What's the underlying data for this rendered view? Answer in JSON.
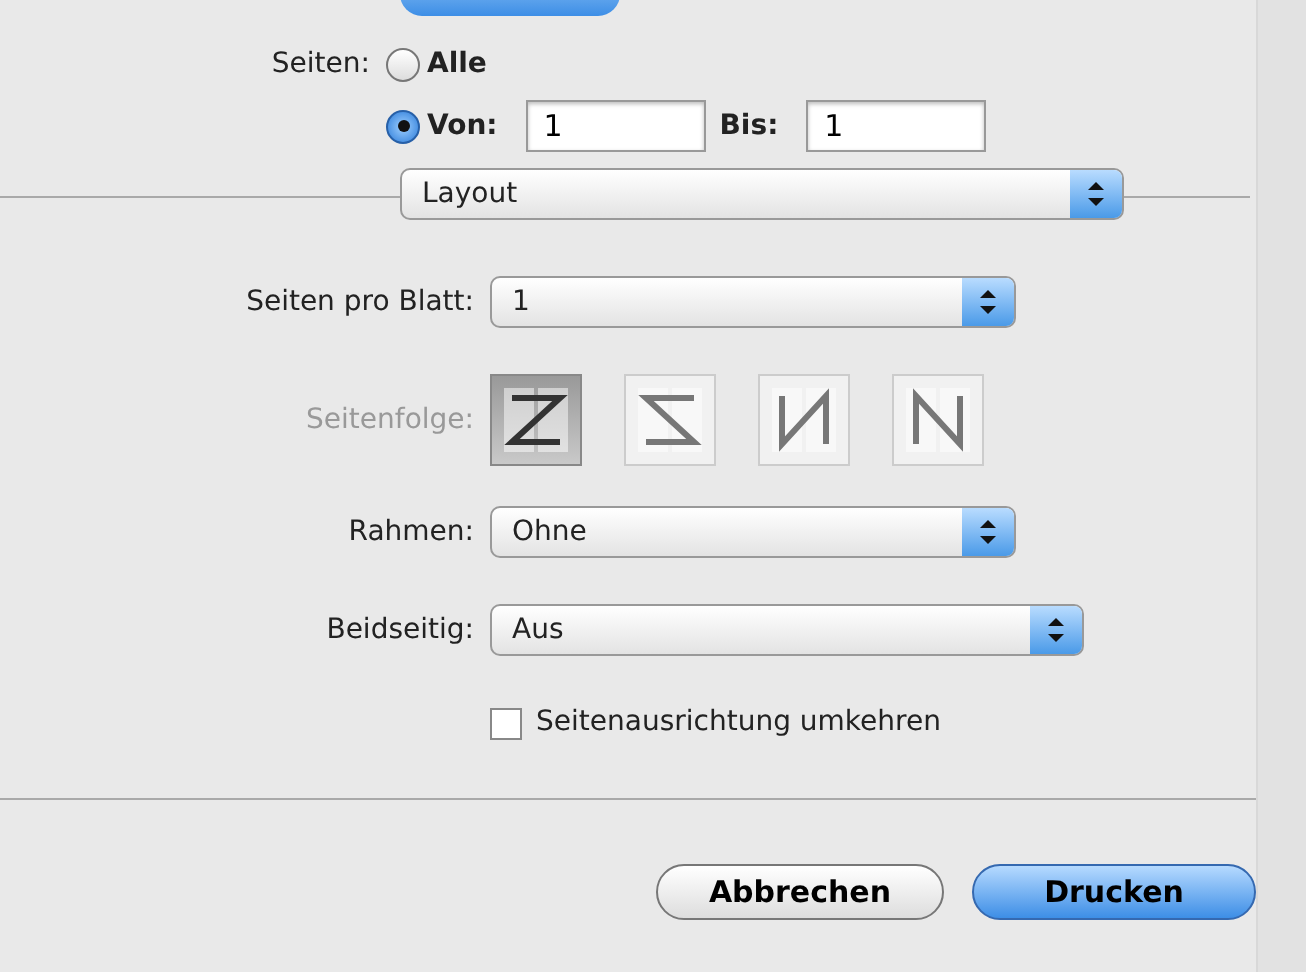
{
  "pages": {
    "label": "Seiten:",
    "options": [
      {
        "kind": "all",
        "label": "Alle",
        "selected": false
      },
      {
        "kind": "range",
        "label": "Von:",
        "selected": true,
        "from": "1",
        "to_label": "Bis:",
        "to": "1"
      }
    ]
  },
  "section_menu": {
    "value": "Layout"
  },
  "fields": [
    {
      "kind": "popup",
      "label": "Seiten pro Blatt:",
      "value": "1",
      "wide": false
    },
    {
      "kind": "order",
      "label": "Seitenfolge:",
      "dimmed": true,
      "options": [
        {
          "kind": "z",
          "selected": true
        },
        {
          "kind": "s",
          "selected": false
        },
        {
          "kind": "n-reverse",
          "selected": false
        },
        {
          "kind": "n",
          "selected": false
        }
      ]
    },
    {
      "kind": "popup",
      "label": "Rahmen:",
      "value": "Ohne",
      "wide": false
    },
    {
      "kind": "popup",
      "label": "Beidseitig:",
      "value": "Aus",
      "wide": true
    },
    {
      "kind": "checkbox",
      "label": "Seitenausrichtung umkehren",
      "checked": false
    }
  ],
  "buttons": [
    {
      "label": "Abbrechen",
      "default": false
    },
    {
      "label": "Drucken",
      "default": true
    }
  ]
}
